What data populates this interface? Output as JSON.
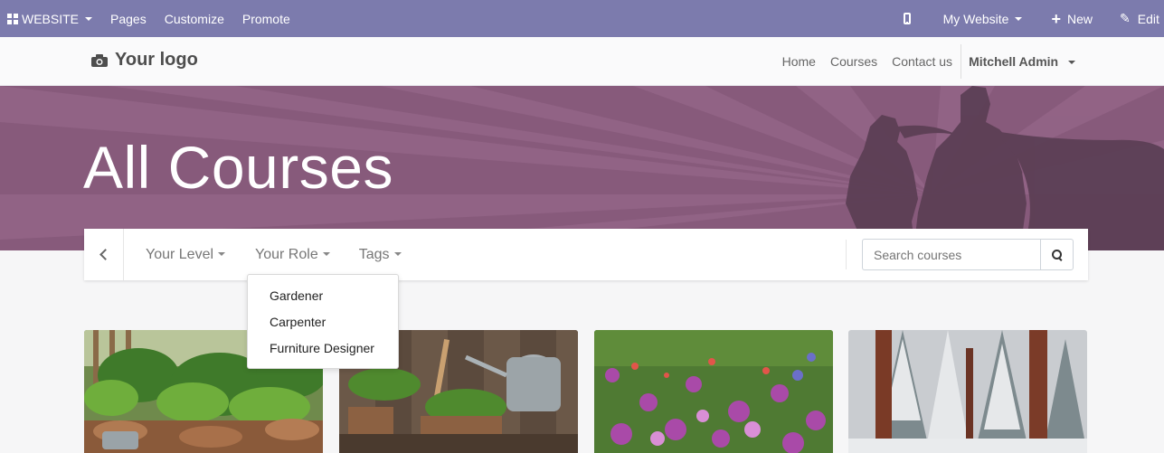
{
  "adminbar": {
    "website_label": "WEBSITE",
    "pages_label": "Pages",
    "customize_label": "Customize",
    "promote_label": "Promote",
    "my_website_label": "My Website",
    "new_label": "New",
    "edit_label": "Edit",
    "background_color": "#7c7bad"
  },
  "header": {
    "logo_text": "Your logo",
    "nav": [
      "Home",
      "Courses",
      "Contact us"
    ],
    "user_name": "Mitchell Admin"
  },
  "banner": {
    "title": "All Courses",
    "color": "#875a7b"
  },
  "filters": {
    "level_label": "Your Level",
    "role_label": "Your Role",
    "tags_label": "Tags",
    "search_placeholder": "Search courses"
  },
  "role_dropdown": {
    "options": [
      "Gardener",
      "Carpenter",
      "Furniture Designer"
    ]
  },
  "cards": [
    {
      "image": "vegetable-plants-photo"
    },
    {
      "image": "garden-tools-photo"
    },
    {
      "image": "flower-meadow-photo"
    },
    {
      "image": "snowy-forest-photo"
    }
  ]
}
